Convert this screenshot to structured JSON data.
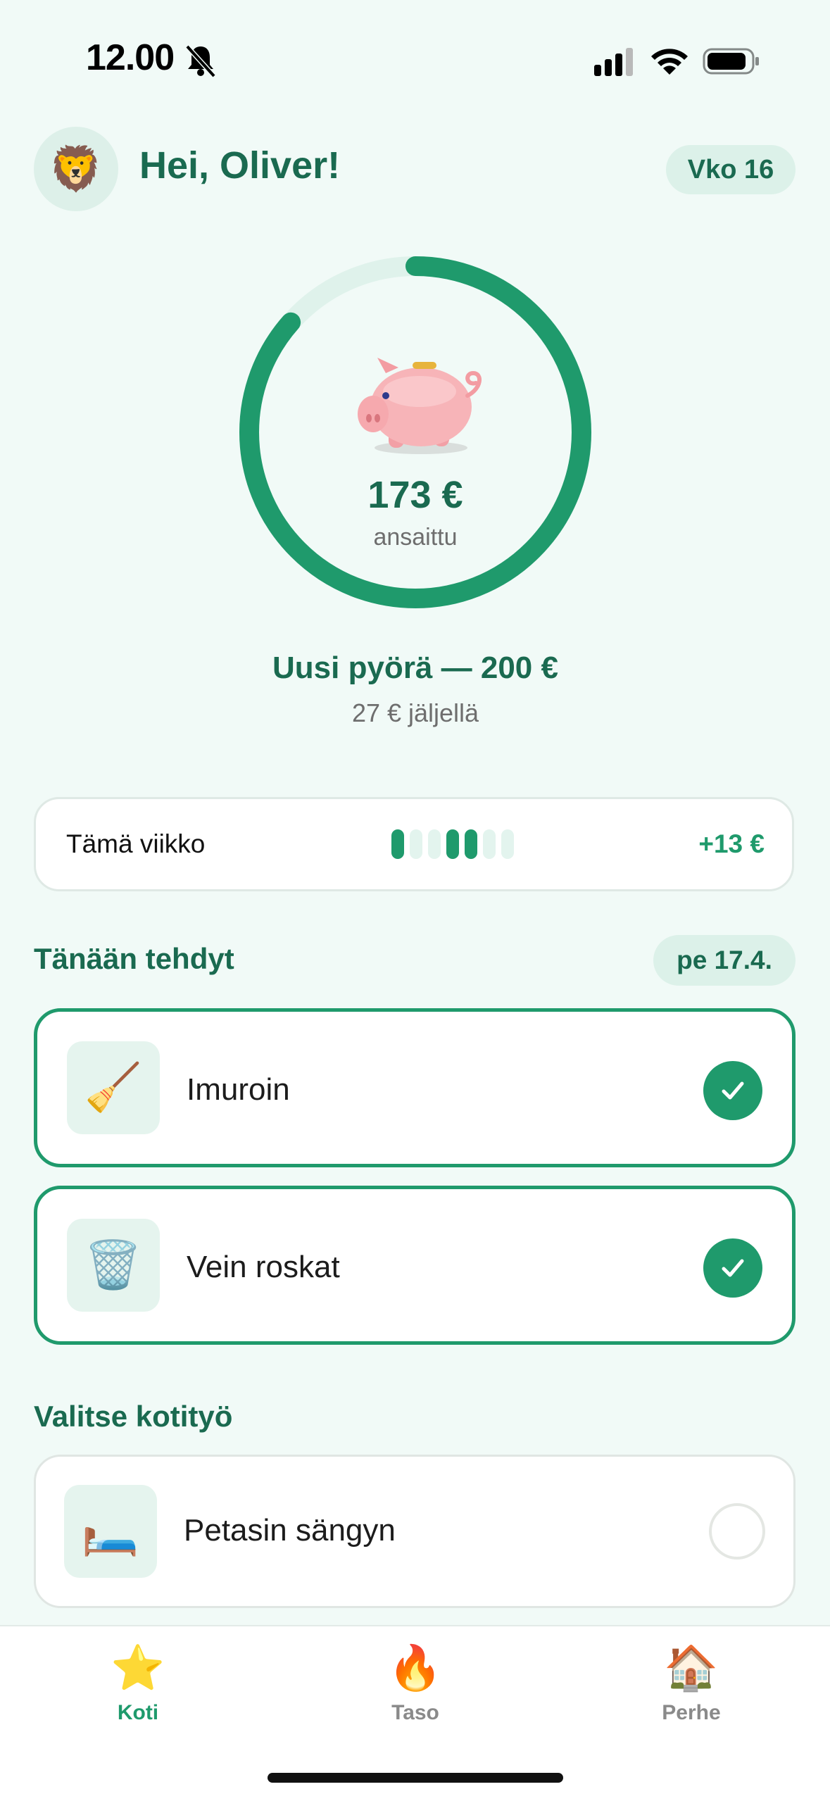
{
  "status_bar": {
    "time": "12.00"
  },
  "header": {
    "avatar_emoji": "🦁",
    "greeting": "Hei, Oliver!",
    "week_badge": "Vko 16"
  },
  "savings": {
    "earned_value": "173 €",
    "earned_label": "ansaittu",
    "progress": 0.865,
    "goal_title": "Uusi pyörä — 200 €",
    "remaining": "27 € jäljellä"
  },
  "week": {
    "label": "Tämä viikko",
    "days_done": [
      true,
      false,
      false,
      true,
      true,
      false,
      false
    ],
    "delta": "+13 €"
  },
  "today": {
    "title": "Tänään tehdyt",
    "date": "pe 17.4.",
    "chores": [
      {
        "icon": "🧹",
        "label": "Imuroin",
        "done": true
      },
      {
        "icon": "🗑️",
        "label": "Vein roskat",
        "done": true
      }
    ]
  },
  "choose": {
    "title": "Valitse kotityö",
    "chores": [
      {
        "icon": "🛏️",
        "label": "Petasin sängyn",
        "done": false
      }
    ]
  },
  "tabs": [
    {
      "icon": "⭐",
      "label": "Koti",
      "active": true
    },
    {
      "icon": "🔥",
      "label": "Taso",
      "active": false
    },
    {
      "icon": "🏠",
      "label": "Perhe",
      "active": false
    }
  ],
  "colors": {
    "accent": "#1f9a6c",
    "heading": "#1a6a50",
    "inactive": "#8a8a8a"
  }
}
